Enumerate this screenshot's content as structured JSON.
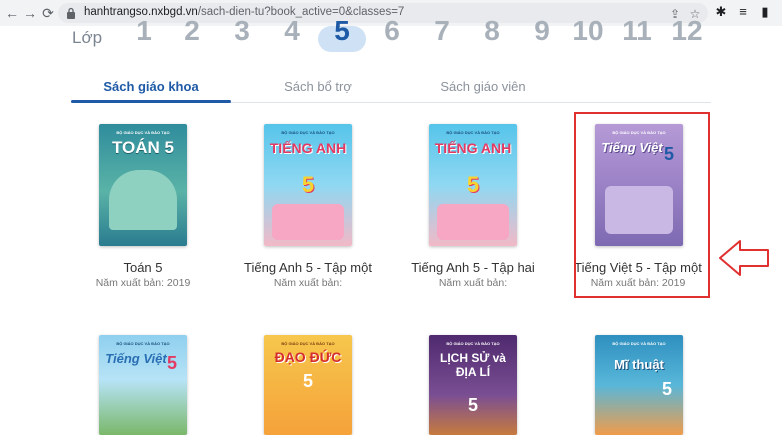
{
  "browser": {
    "url_host": "hanhtrangso.nxbgd.vn",
    "url_path": "/sach-dien-tu?book_active=0&classes=7"
  },
  "grades": {
    "label": "Lớp",
    "items": [
      "1",
      "2",
      "3",
      "4",
      "5",
      "6",
      "7",
      "8",
      "9",
      "10",
      "11",
      "12"
    ],
    "active": "5"
  },
  "tabs": [
    {
      "label": "Sách giáo khoa"
    },
    {
      "label": "Sách bổ trợ"
    },
    {
      "label": "Sách giáo viên"
    }
  ],
  "books_row1": [
    {
      "title": "Toán 5",
      "year": "Năm xuất bản: 2019",
      "cover_text": "TOÁN 5",
      "color": "#3a9aa6"
    },
    {
      "title": "Tiếng Anh 5 - Tập một",
      "year": "Năm xuất bản:",
      "cover_text": "TIẾNG ANH",
      "color": "#5fc6e8"
    },
    {
      "title": "Tiếng Anh 5 - Tập hai",
      "year": "Năm xuất bản:",
      "cover_text": "TIẾNG ANH",
      "color": "#5fc6e8"
    },
    {
      "title": "Tiếng Việt 5 - Tập một",
      "year": "Năm xuất bản: 2019",
      "cover_text": "Tiếng Việt",
      "color": "#9f86c8"
    }
  ],
  "books_row2": [
    {
      "cover_text": "Tiếng Việt",
      "color": "#7fc0e4"
    },
    {
      "cover_text": "ĐẠO ĐỨC",
      "color": "#f4a93a"
    },
    {
      "cover_text": "LỊCH SỬ và ĐỊA LÍ",
      "color": "#6b3e8a"
    },
    {
      "cover_text": "Mĩ thuật",
      "color": "#3fa7c7"
    }
  ],
  "cover_small_text": "BỘ GIÁO DỤC VÀ ĐÀO TẠO"
}
